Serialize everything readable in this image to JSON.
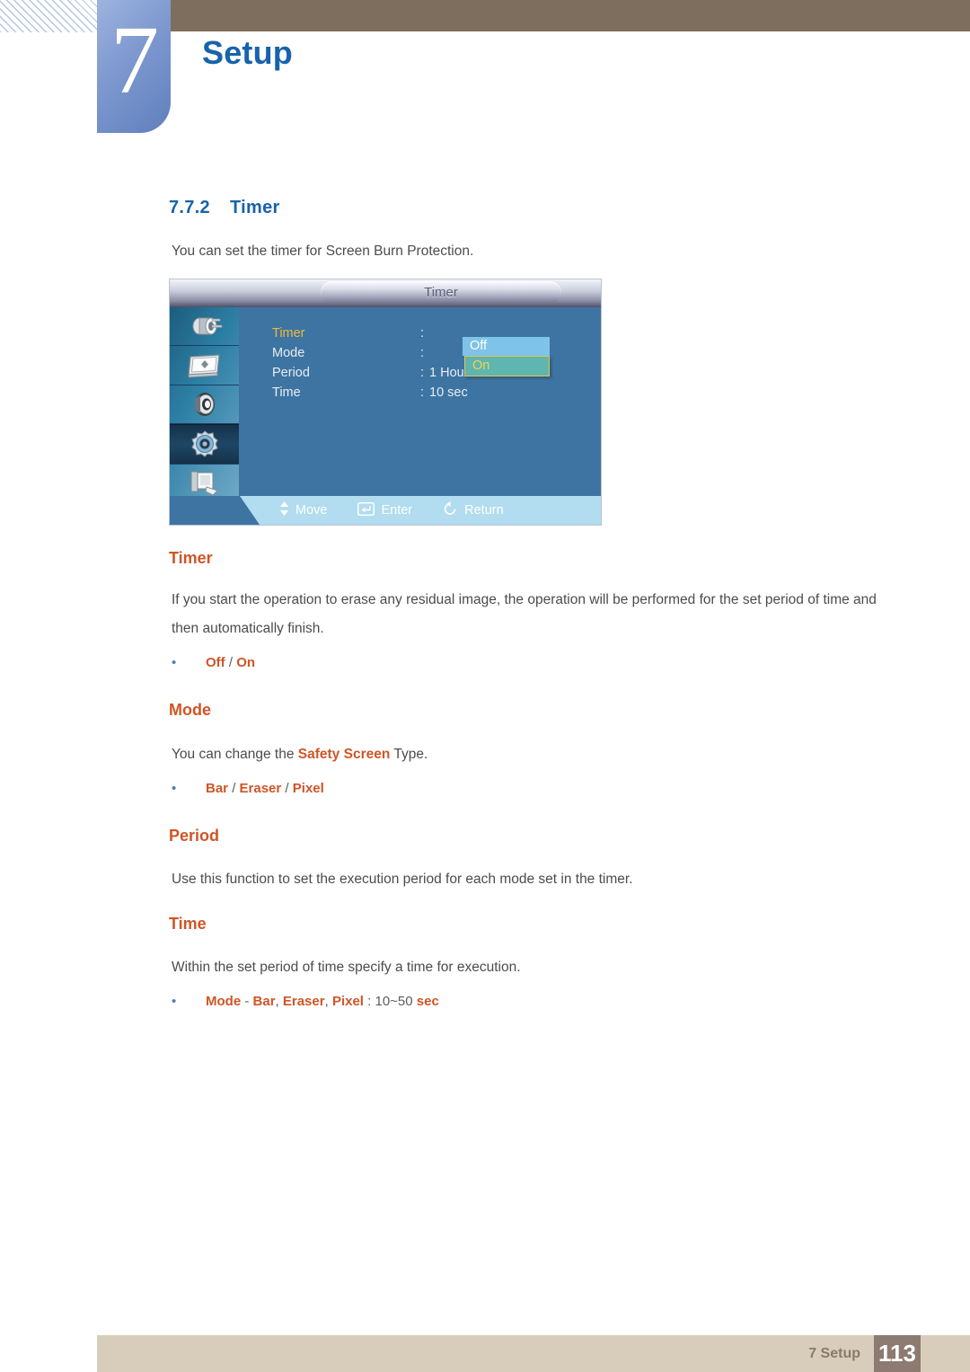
{
  "header": {
    "chapter_number": "7",
    "chapter_title": "Setup"
  },
  "section": {
    "number": "7.7.2",
    "title": "Timer",
    "intro": "You can set the timer for Screen Burn Protection."
  },
  "osd": {
    "title": "Timer",
    "sidebar_icons": [
      "input-source-icon",
      "picture-display-icon",
      "sound-speaker-icon",
      "setup-gear-icon",
      "multi-control-icon"
    ],
    "rows": [
      {
        "label": "Timer",
        "colon": ":",
        "value": "Off"
      },
      {
        "label": "Mode",
        "colon": ":",
        "value": "On"
      },
      {
        "label": "Period",
        "colon": ":",
        "value": "1 Hour"
      },
      {
        "label": "Time",
        "colon": ":",
        "value": "10 sec"
      }
    ],
    "dropdown": {
      "unselected_option": "Off",
      "selected_option": "On"
    },
    "footer_hints": [
      {
        "icon": "up-down-arrow-icon",
        "label": "Move"
      },
      {
        "icon": "enter-key-icon",
        "label": "Enter"
      },
      {
        "icon": "return-arrow-icon",
        "label": "Return"
      }
    ]
  },
  "content": {
    "timer": {
      "heading": "Timer",
      "paragraph": "If you start the operation to erase any residual image, the operation will be performed for the set period of time and then automatically finish.",
      "bullet": {
        "opt1": "Off",
        "sep": "/",
        "opt2": "On"
      }
    },
    "mode": {
      "heading": "Mode",
      "para_pre": "You can change the ",
      "para_hl": "Safety Screen",
      "para_post": " Type.",
      "bullet": {
        "opt1": "Bar",
        "sep1": "/",
        "opt2": "Eraser",
        "sep2": "/",
        "opt3": "Pixel"
      }
    },
    "period": {
      "heading": "Period",
      "paragraph": "Use this function to set the execution period for each mode set in the timer."
    },
    "time": {
      "heading": "Time",
      "paragraph": "Within the set period of time specify a time for execution.",
      "bullet": {
        "mode": "Mode",
        "dash": "-",
        "opt1": "Bar",
        "comma1": ",",
        "opt2": "Eraser",
        "comma2": ",",
        "opt3": "Pixel",
        "colon": ":",
        "range": "10~50",
        "unit": "sec"
      }
    }
  },
  "footer": {
    "label": "7 Setup",
    "page_number": "113"
  },
  "colors": {
    "chapter_blue": "#1763ab",
    "heading_orange": "#cf5526",
    "brown_bar": "#7d6e5e",
    "footer_bar": "#d8cdba",
    "footer_page_box": "#8d7a70",
    "osd_body": "#3d74a2",
    "osd_highlight_yellow": "#f0b93c"
  }
}
